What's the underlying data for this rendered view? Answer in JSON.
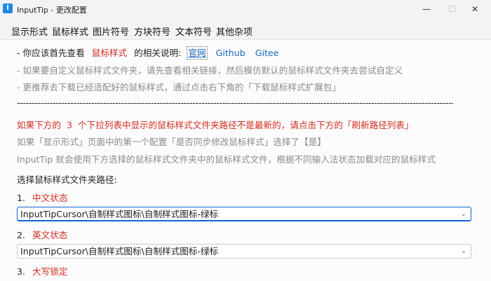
{
  "window": {
    "app_icon_letter": "I",
    "title": "InputTip - 更改配置",
    "minimize": "—",
    "maximize": "☐",
    "close": "✕"
  },
  "menu": {
    "items": [
      "显示形式",
      "鼠标样式",
      "图片符号",
      "方块符号",
      "文本符号",
      "其他杂项"
    ]
  },
  "content": {
    "intro": {
      "prefix": "- 你应该首先查看",
      "mouse_style": "鼠标样式",
      "middle": "的相关说明:",
      "link_official": "官网",
      "link_github": "Github",
      "link_gitee": "Gitee"
    },
    "hint1": "- 如果要自定义鼠标样式文件夹，请先查看相关链接，然后模仿默认的鼠标样式文件夹去尝试自定义",
    "hint2": "- 更推荐去下载已经适配好的鼠标样式，通过点击右下角的「下载鼠标样式扩展包」",
    "separator": "------------------------------------------------------------------------------------------------------------------------------------------------------------------------------------------------------------------------------------------------------------",
    "warning": {
      "part1": "如果下方的",
      "num": "3",
      "part2": "个下拉列表中显示的鼠标样式文件夹路径不是最新的，请点击下方的「刷新路径列表」"
    },
    "note1": "如果「显示形式」页面中的第一个配置「是否同步修改鼠标样式」选择了【是】",
    "note2": "InputTip 就会使用下方选择的鼠标样式文件夹中的鼠标样式文件，根据不同输入法状态加载对应的鼠标样式",
    "select_label": "选择鼠标样式文件夹路径:",
    "items": [
      {
        "num": "1.",
        "label": "中文状态",
        "value": "InputTipCursor\\自制样式图标\\自制样式图标-绿标"
      },
      {
        "num": "2.",
        "label": "英文状态",
        "value": "InputTipCursor\\自制样式图标\\自制样式图标-绿标"
      },
      {
        "num": "3.",
        "label": "大写锁定"
      }
    ],
    "chevron": "⌄"
  }
}
